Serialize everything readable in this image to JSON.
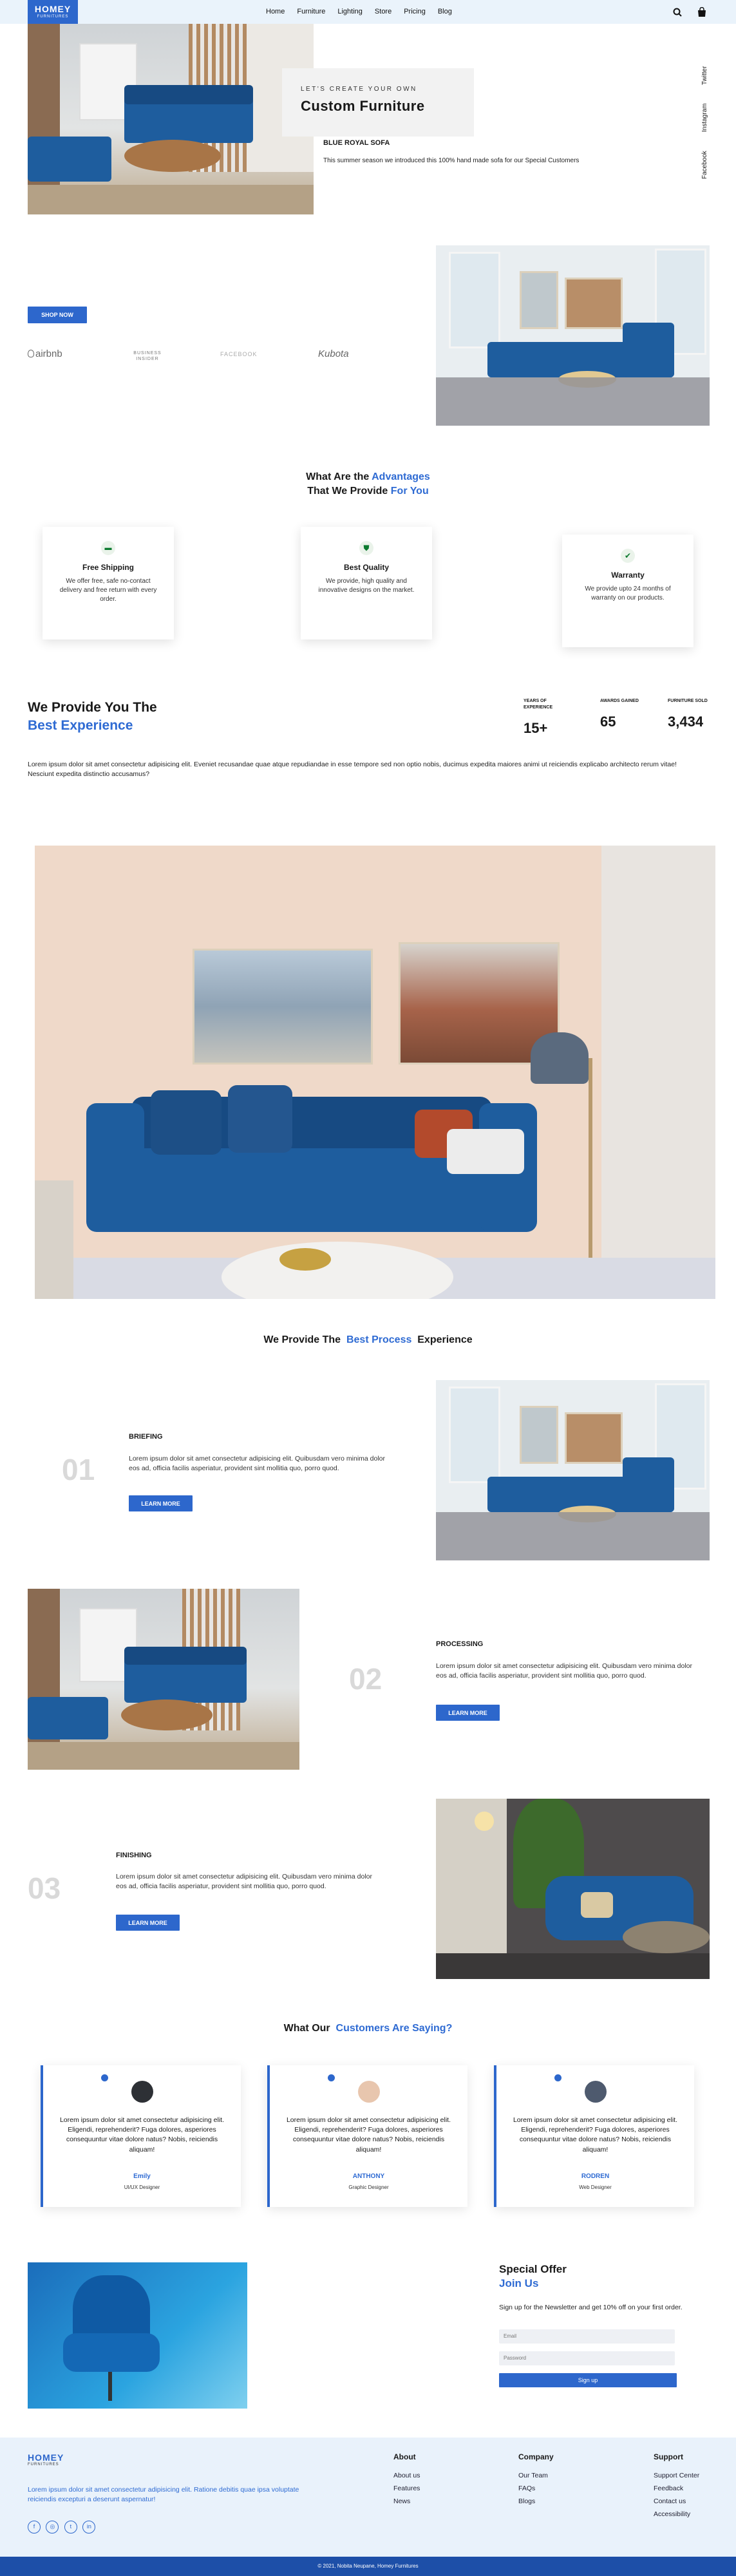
{
  "header": {
    "logo_title": "HOMEY",
    "logo_subtitle": "FURNITURES",
    "nav": [
      "Home",
      "Furniture",
      "Lighting",
      "Store",
      "Pricing",
      "Blog"
    ],
    "search_icon": "search-icon",
    "cart_icon": "shopping-bag-icon"
  },
  "hero": {
    "eyebrow": "LET'S CREATE YOUR OWN",
    "title": "Custom Furniture",
    "product_name": "BLUE ROYAL SOFA",
    "product_desc": "This summer season we introduced this 100% hand made sofa for our Special Customers",
    "social": [
      "Twitter",
      "Instagram",
      "Facebook"
    ]
  },
  "shop": {
    "button": "SHOP NOW",
    "partners": [
      "airbnb",
      "BUSINESS INSIDER",
      "FACEBOOK",
      "Kubota"
    ]
  },
  "advantages": {
    "title_line1": "What Are the",
    "title_line1_accent": "Advantages",
    "title_line2": "That We Provide",
    "title_line2_accent": "For You",
    "cards": [
      {
        "icon": "truck-icon",
        "title": "Free Shipping",
        "text": "We offer free, safe no-contact delivery and free return with every order."
      },
      {
        "icon": "shield-icon",
        "title": "Best Quality",
        "text": "We provide, high quality and innovative designs on the market."
      },
      {
        "icon": "badge-check-icon",
        "title": "Warranty",
        "text": "We provide upto 24 months of warranty on our products."
      }
    ]
  },
  "experience": {
    "title_line1": "We Provide You The",
    "title_line2": "Best Experience",
    "stats": [
      {
        "label": "YEARS OF EXPERIENCE",
        "value": "15+"
      },
      {
        "label": "AWARDS GAINED",
        "value": "65"
      },
      {
        "label": "FURNITURE SOLD",
        "value": "3,434"
      }
    ],
    "paragraph": "Lorem ipsum dolor sit amet consectetur adipisicing elit. Eveniet recusandae quae atque repudiandae in esse tempore sed non optio nobis, ducimus expedita maiores animi ut reiciendis explicabo architecto rerum vitae! Nesciunt expedita distinctio accusamus?"
  },
  "process": {
    "title": "We Provide The",
    "title_accent": "Best Process",
    "title_end": "Experience",
    "steps": [
      {
        "num": "01",
        "title": "BRIEFING",
        "text": "Lorem ipsum dolor sit amet consectetur adipisicing elit. Quibusdam vero minima dolor eos ad, officia facilis asperiatur, provident sint mollitia quo, porro quod.",
        "button": "LEARN MORE"
      },
      {
        "num": "02",
        "title": "PROCESSING",
        "text": "Lorem ipsum dolor sit amet consectetur adipisicing elit. Quibusdam vero minima dolor eos ad, officia facilis asperiatur, provident sint mollitia quo, porro quod.",
        "button": "LEARN MORE"
      },
      {
        "num": "03",
        "title": "FINISHING",
        "text": "Lorem ipsum dolor sit amet consectetur adipisicing elit. Quibusdam vero minima dolor eos ad, officia facilis asperiatur, provident sint mollitia quo, porro quod.",
        "button": "LEARN MORE"
      }
    ]
  },
  "testimonials": {
    "title": "What Our",
    "title_accent": "Customers Are Saying?",
    "items": [
      {
        "text": "Lorem ipsum dolor sit amet consectetur adipisicing elit. Eligendi, reprehenderit? Fuga dolores, asperiores consequuntur vitae dolore natus? Nobis, reiciendis aliquam!",
        "name": "Emily",
        "role": "UI/UX Designer"
      },
      {
        "text": "Lorem ipsum dolor sit amet consectetur adipisicing elit. Eligendi, reprehenderit? Fuga dolores, asperiores consequuntur vitae dolore natus? Nobis, reiciendis aliquam!",
        "name": "ANTHONY",
        "role": "Graphic Designer"
      },
      {
        "text": "Lorem ipsum dolor sit amet consectetur adipisicing elit. Eligendi, reprehenderit? Fuga dolores, asperiores consequuntur vitae dolore natus? Nobis, reiciendis aliquam!",
        "name": "RODREN",
        "role": "Web Designer"
      }
    ]
  },
  "offer": {
    "title": "Special Offer",
    "title_accent": "Join Us",
    "text": "Sign up for the Newsletter and get 10% off on your first order.",
    "email_placeholder": "Email",
    "password_placeholder": "Password",
    "button": "Sign up"
  },
  "footer": {
    "logo_title": "HOMEY",
    "logo_subtitle": "FURNITURES",
    "text": "Lorem ipsum dolor sit amet consectetur adipisicing elit. Ratione debitis quae ipsa voluptate reiciendis excepturi a deserunt aspernatur!",
    "socials": [
      "facebook-icon",
      "instagram-icon",
      "twitter-icon",
      "linkedin-icon"
    ],
    "columns": [
      {
        "title": "About",
        "items": [
          "About us",
          "Features",
          "News"
        ]
      },
      {
        "title": "Company",
        "items": [
          "Our Team",
          "FAQs",
          "Blogs"
        ]
      },
      {
        "title": "Support",
        "items": [
          "Support Center",
          "Feedback",
          "Contact us",
          "Accessibility"
        ]
      }
    ],
    "copyright": "© 2021, Nobita Neupane, Homey Furnitures"
  },
  "colors": {
    "accent": "#2d67cc",
    "header_bg": "#eaf3fb",
    "sofa": "#1e5d9e"
  }
}
